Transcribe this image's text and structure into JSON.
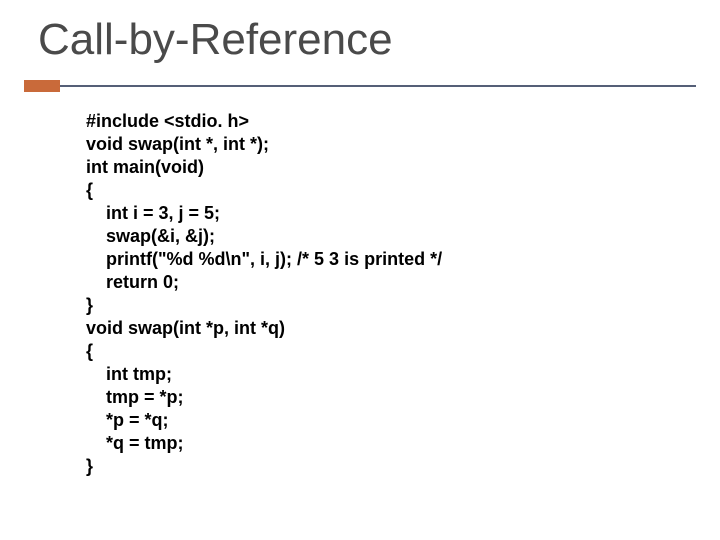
{
  "title": "Call-by-Reference",
  "code": "#include <stdio. h>\nvoid swap(int *, int *);\nint main(void)\n{\n    int i = 3, j = 5;\n    swap(&i, &j);\n    printf(\"%d %d\\n\", i, j); /* 5 3 is printed */\n    return 0;\n}\nvoid swap(int *p, int *q)\n{\n    int tmp;\n    tmp = *p;\n    *p = *q;\n    *q = tmp;\n}"
}
